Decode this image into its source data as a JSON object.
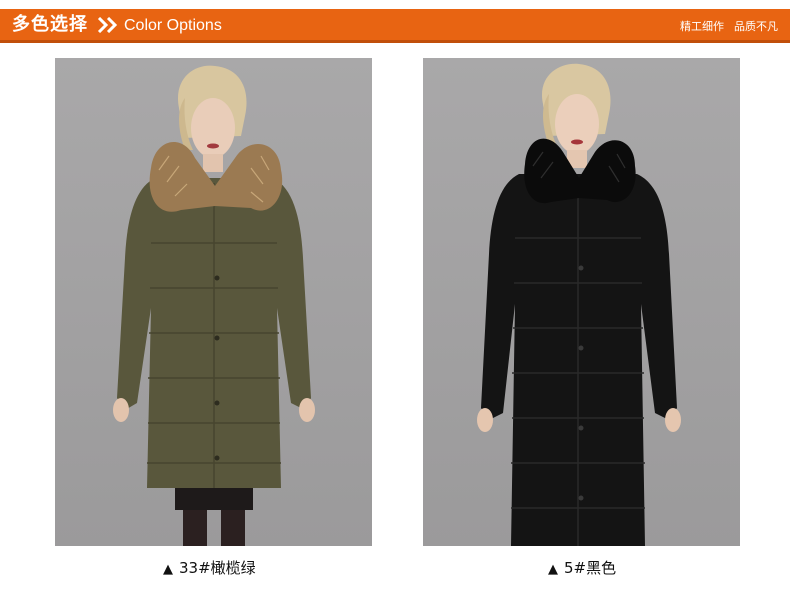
{
  "header": {
    "title_cn": "多色选择",
    "title_en": "Color Options",
    "slogan_1": "精工细作",
    "slogan_2": "品质不凡",
    "bar_color": "#e86412"
  },
  "icons": {
    "header_arrow": "double-chevron-right-icon",
    "caption_marker": "triangle-up-icon"
  },
  "products": [
    {
      "marker": "▲",
      "label": "33#橄榄绿",
      "coat_color": "#59573c",
      "fur_color": "#9b7a52"
    },
    {
      "marker": "▲",
      "label": "5#黑色",
      "coat_color": "#141414",
      "fur_color": "#0b0b0b"
    }
  ]
}
